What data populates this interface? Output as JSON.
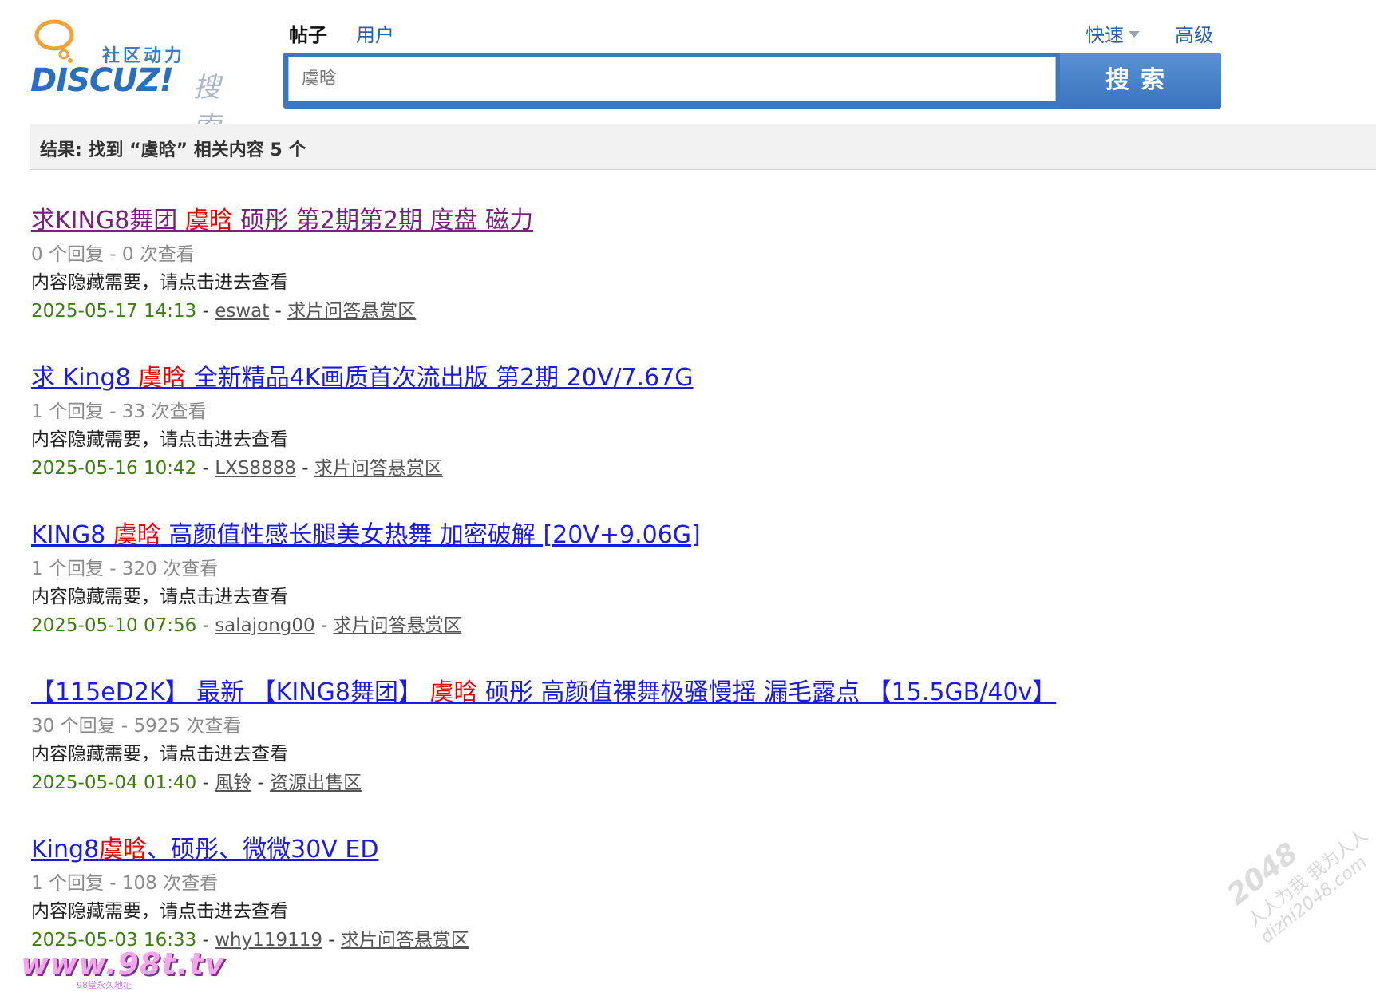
{
  "logo": {
    "cn_text": "社区动力",
    "brand": "DISCUZ!",
    "search_word": "搜索"
  },
  "search": {
    "tabs": [
      {
        "label": "帖子",
        "active": true
      },
      {
        "label": "用户",
        "active": false
      }
    ],
    "quick_label": "快速",
    "advanced_label": "高级",
    "query": "虞晗",
    "button_label": "搜索"
  },
  "result_summary": "结果: 找到 “虞晗” 相关内容 5 个",
  "results": [
    {
      "title_before": "求KING8舞团 ",
      "keyword": "虞晗",
      "title_after": " 硕彤 第2期第2期 度盘 磁力",
      "visited": true,
      "stats": "0 个回复 - 0 次查看",
      "desc": "内容隐藏需要，请点击进去查看",
      "date": "2025-05-17 14:13",
      "author": "eswat",
      "forum": "求片问答悬赏区"
    },
    {
      "title_before": "求 King8 ",
      "keyword": "虞晗",
      "title_after": " 全新精品4K画质首次流出版 第2期 20V/7.67G",
      "visited": false,
      "stats": "1 个回复 - 33 次查看",
      "desc": "内容隐藏需要，请点击进去查看",
      "date": "2025-05-16 10:42",
      "author": "LXS8888",
      "forum": "求片问答悬赏区"
    },
    {
      "title_before": "KING8 ",
      "keyword": "虞晗",
      "title_after": " 高颜值性感长腿美女热舞 加密破解 [20V+9.06G]",
      "visited": false,
      "stats": "1 个回复 - 320 次查看",
      "desc": "内容隐藏需要，请点击进去查看",
      "date": "2025-05-10 07:56",
      "author": "salajong00",
      "forum": "求片问答悬赏区"
    },
    {
      "title_before": "【115eD2K】 最新 【KING8舞团】 ",
      "keyword": "虞晗",
      "title_after": " 硕彤 高颜值裸舞极骚慢摇 漏毛露点 【15.5GB/40v】",
      "visited": false,
      "stats": "30 个回复 - 5925 次查看",
      "desc": "内容隐藏需要，请点击进去查看",
      "date": "2025-05-04 01:40",
      "author": "風铃",
      "forum": "资源出售区"
    },
    {
      "title_before": "King8",
      "keyword": "虞晗",
      "title_after": "、硕彤、微微30V ED",
      "visited": false,
      "stats": "1 个回复 - 108 次查看",
      "desc": "内容隐藏需要，请点击进去查看",
      "date": "2025-05-03 16:33",
      "author": "why119119",
      "forum": "求片问答悬赏区"
    }
  ],
  "watermarks": {
    "left_site": "www.98t.tv",
    "left_sub": "98堂永久地址",
    "right_num": "2048",
    "right_line1": "人人为我 我为人人",
    "right_line2": "dizhi2048.com"
  },
  "colors": {
    "keyword": "#e60000",
    "link": "#1c1ce0",
    "visited": "#7b1f7f",
    "date": "#3d7d10",
    "accent": "#3b78c3"
  }
}
